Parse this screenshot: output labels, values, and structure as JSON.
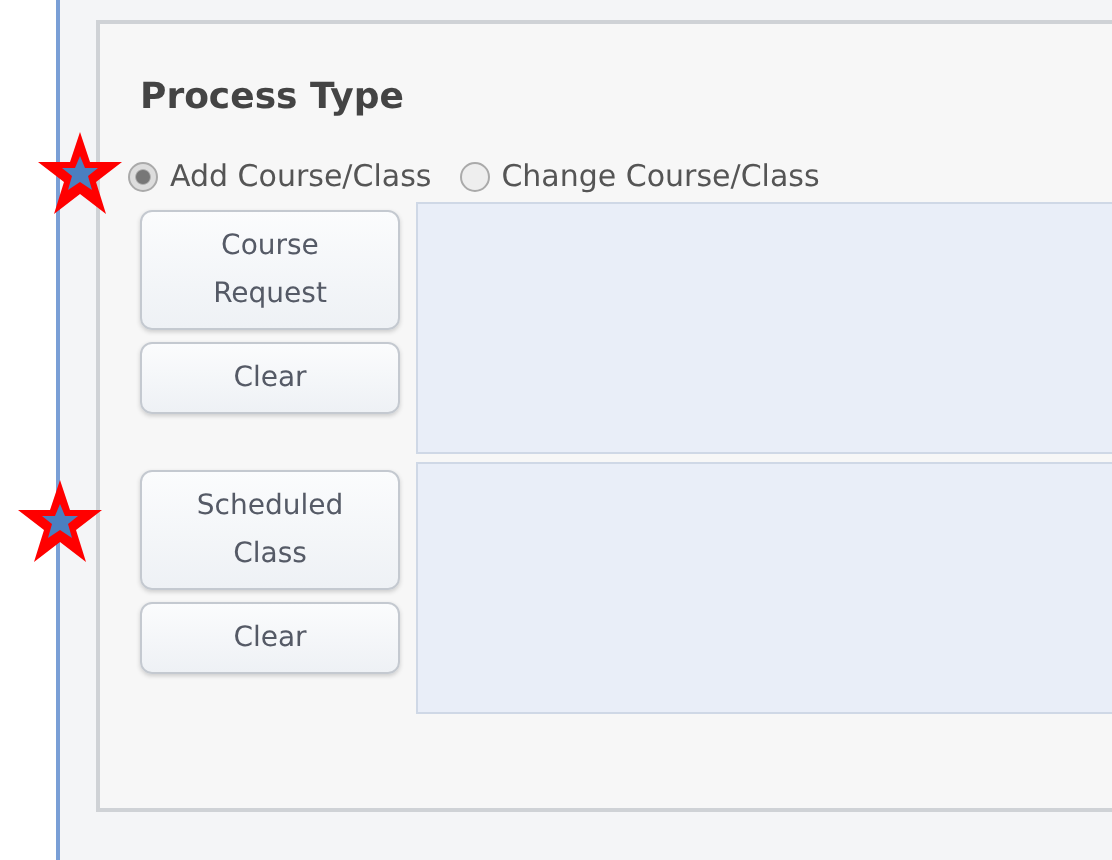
{
  "section": {
    "title": "Process Type"
  },
  "process_options": [
    {
      "label": "Add Course/Class",
      "selected": true,
      "starred": true
    },
    {
      "label": "Change Course/Class",
      "selected": false,
      "starred": false
    }
  ],
  "groups": [
    {
      "starred": false,
      "buttons": [
        "Course Request",
        "Clear"
      ]
    },
    {
      "starred": true,
      "buttons": [
        "Scheduled Class",
        "Clear"
      ]
    }
  ]
}
